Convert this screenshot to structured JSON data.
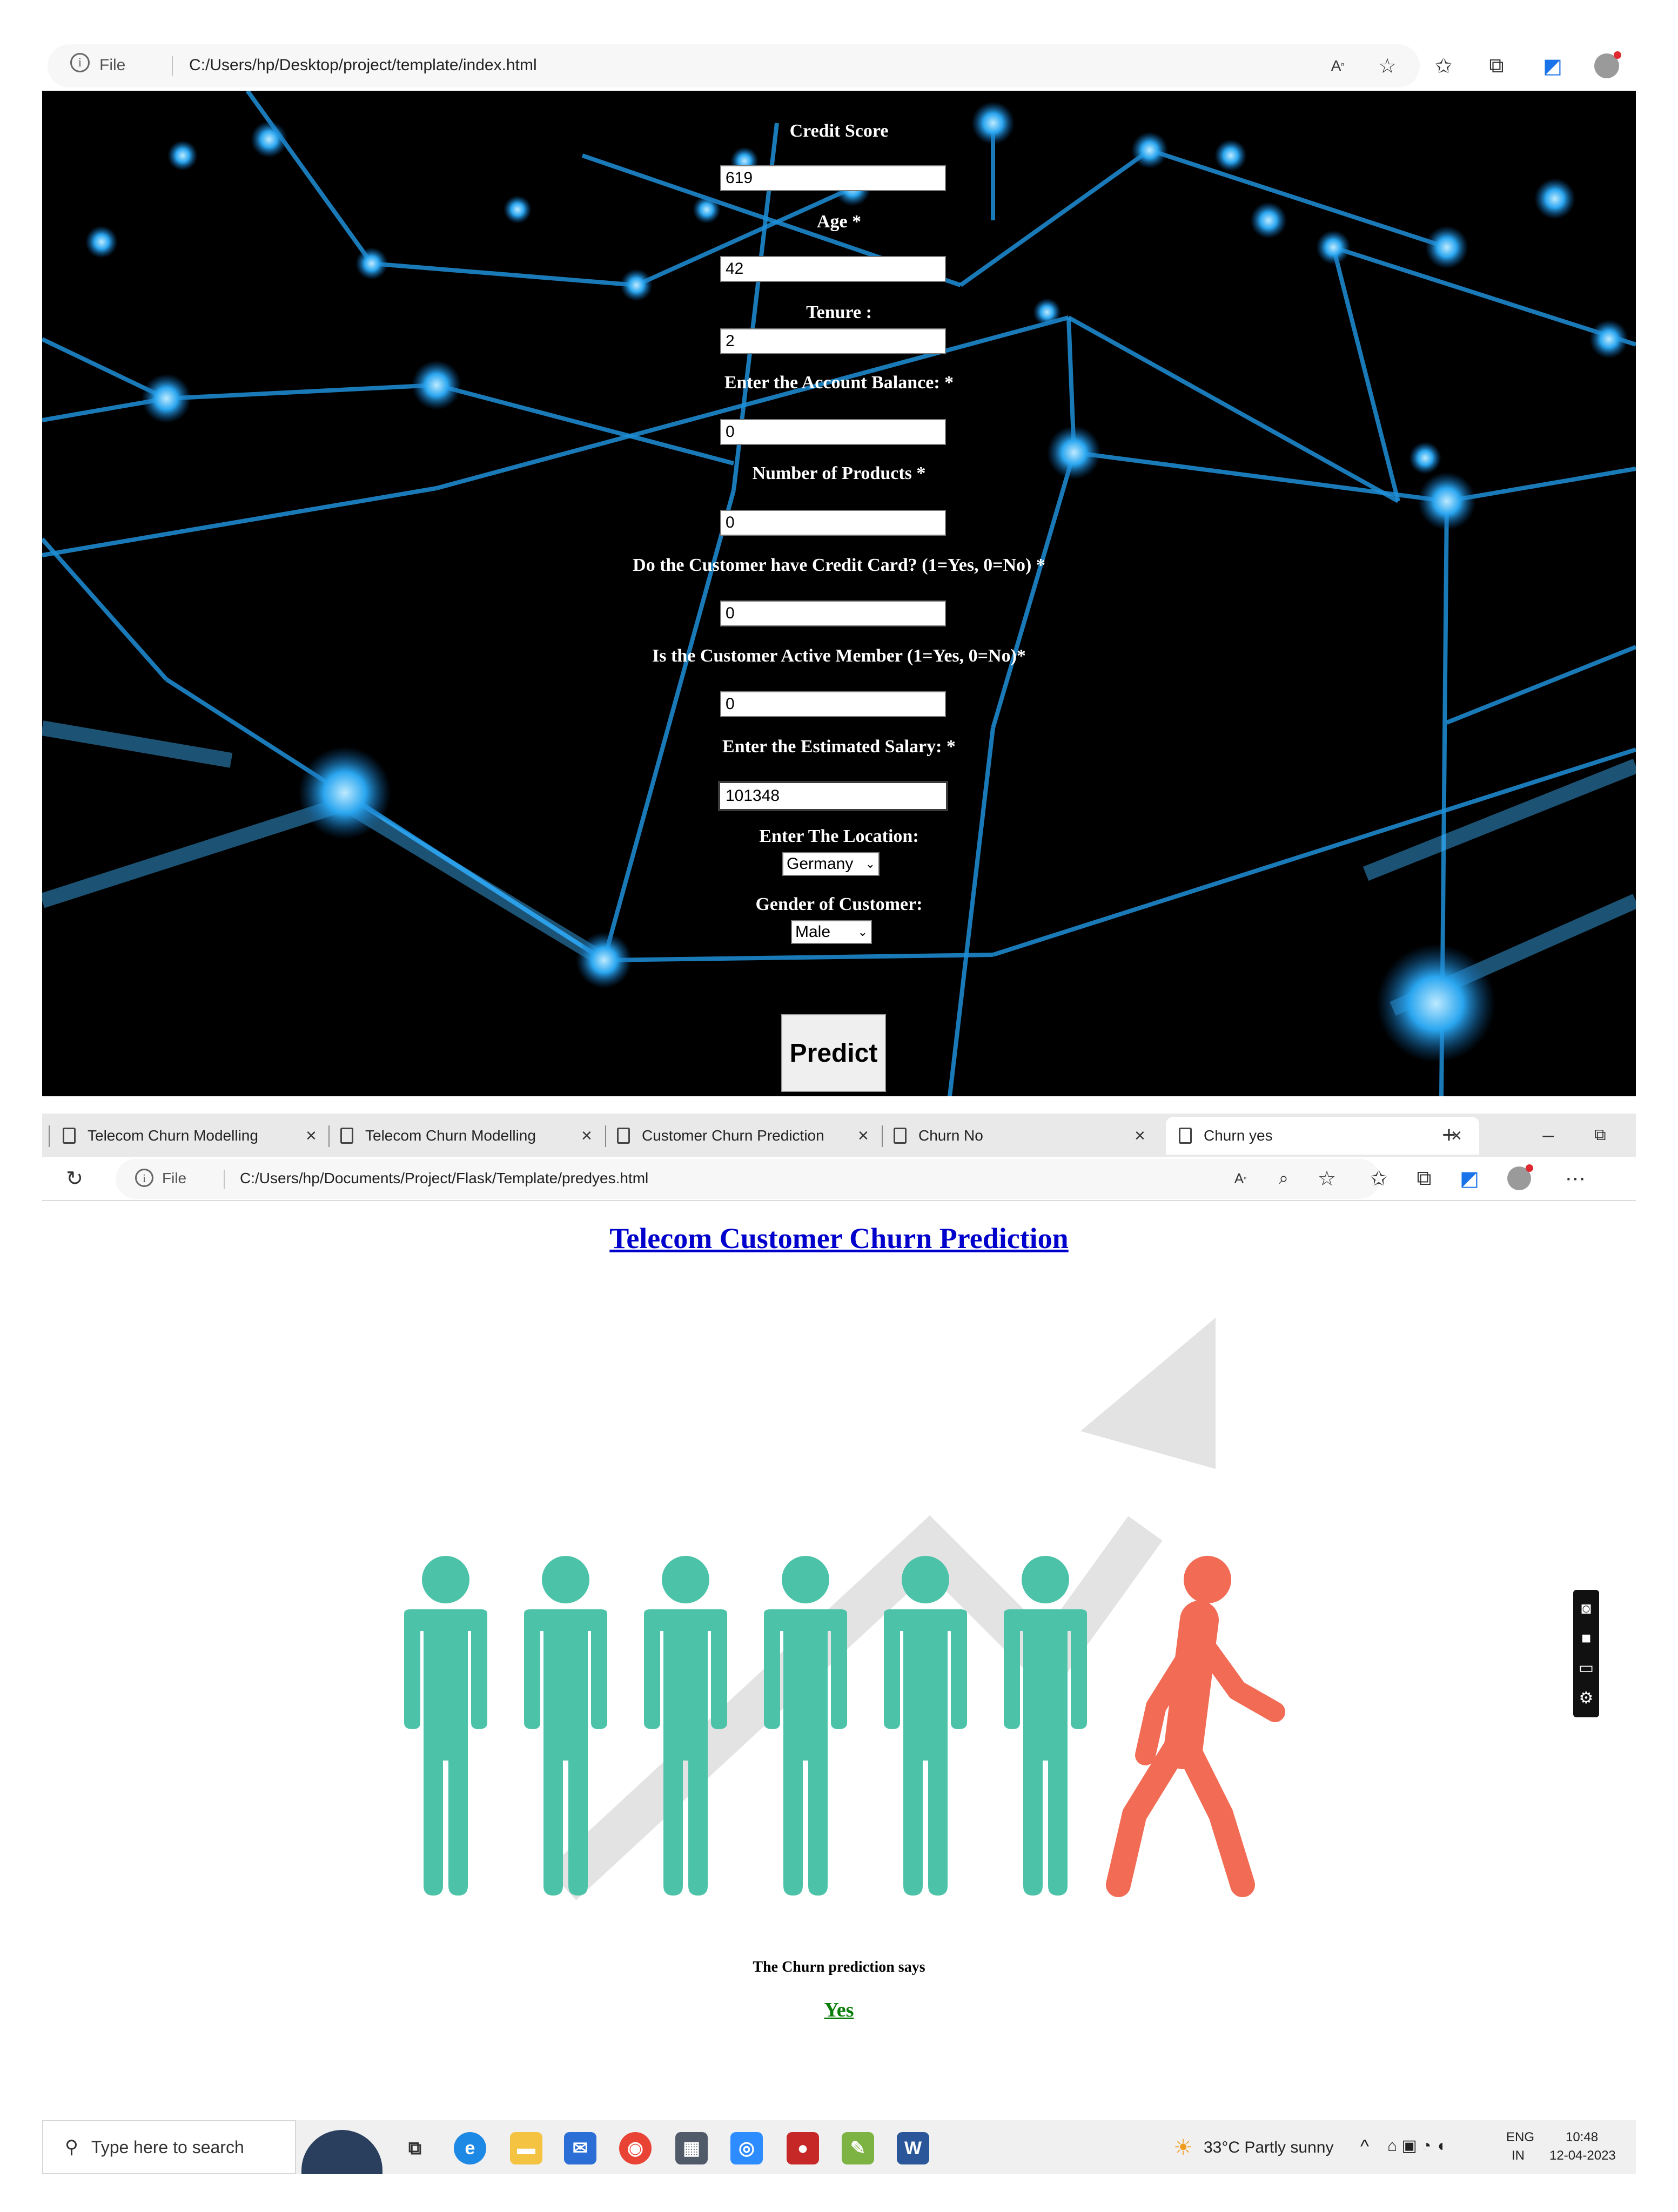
{
  "browser1": {
    "info_label": "File",
    "path": "C:/Users/hp/Desktop/project/template/index.html"
  },
  "form": {
    "credit_score_label": "Credit Score",
    "credit_score_value": "619",
    "age_label": "Age *",
    "age_value": "42",
    "tenure_label": "Tenure :",
    "tenure_value": "2",
    "balance_label": "Enter the Account Balance: *",
    "balance_value": "0",
    "products_label": "Number of Products *",
    "products_value": "0",
    "credit_card_label": "Do the Customer have Credit Card? (1=Yes, 0=No) *",
    "credit_card_value": "0",
    "active_label": "Is the Customer Active Member (1=Yes, 0=No)*",
    "active_value": "0",
    "salary_label": "Enter the Estimated Salary: *",
    "salary_value": "101348",
    "location_label": "Enter The Location:",
    "location_value": "Germany",
    "gender_label": "Gender of Customer:",
    "gender_value": "Male",
    "predict_label": "Predict"
  },
  "browser2": {
    "tabs": [
      {
        "title": "Telecom Churn Modelling"
      },
      {
        "title": "Telecom Churn Modelling"
      },
      {
        "title": "Customer Churn Prediction"
      },
      {
        "title": "Churn No"
      },
      {
        "title": "Churn yes"
      }
    ],
    "info_label": "File",
    "path": "C:/Users/hp/Documents/Project/Flask/Template/predyes.html"
  },
  "result": {
    "title": "Telecom Customer Churn Prediction",
    "caption": "The Churn prediction says",
    "answer": "Yes"
  },
  "taskbar": {
    "search_placeholder": "Type here to search",
    "weather": "33°C  Partly sunny",
    "lang_top": "ENG",
    "lang_bottom": "IN",
    "time": "10:48",
    "date": "12-04-2023"
  },
  "colors": {
    "person_teal": "#4cc3a9",
    "person_red": "#f26b54",
    "arrow_gray": "#e3e3e3",
    "network_blue": "#29a9f5",
    "link_blue": "#0000cc",
    "yes_green": "#0a7d0a"
  }
}
